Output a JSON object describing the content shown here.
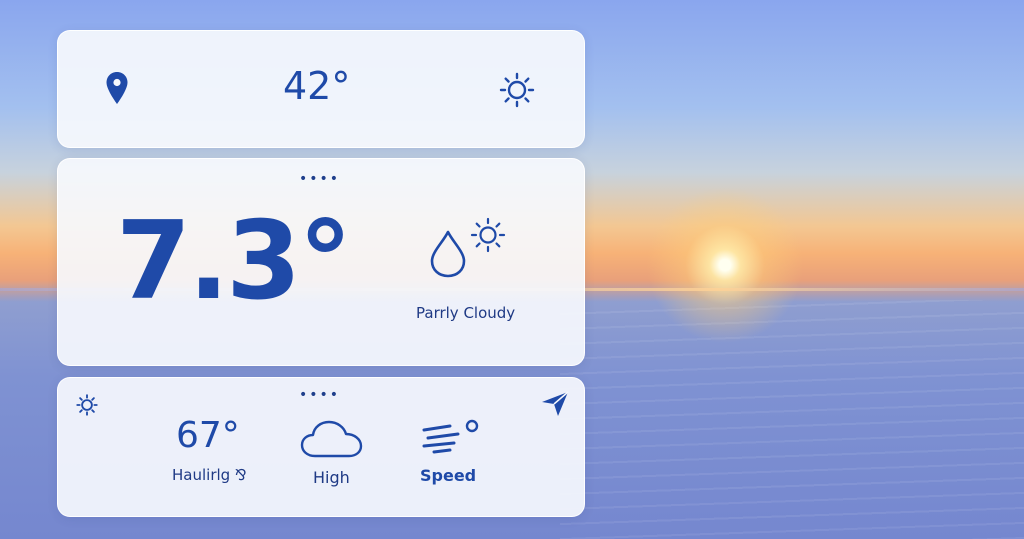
{
  "colors": {
    "accent": "#1f4aa8",
    "card_bg": "#f6f8fd"
  },
  "top_bar": {
    "location_icon": "map-pin-icon",
    "temperature": "42°",
    "settings_icon": "sun-gear-icon"
  },
  "current": {
    "temperature": "7.3°",
    "page_dots": "••••",
    "condition_icons": [
      "raindrop-icon",
      "sun-icon"
    ],
    "condition": "Parrly Cloudy"
  },
  "details": {
    "page_dots": "••••",
    "corner_left_icon": "sun-gear-icon",
    "corner_right_icon": "navigation-arrow-icon",
    "items": [
      {
        "value": "67°",
        "label": "Haulirlg ⅋"
      },
      {
        "icon": "cloud-icon",
        "label": "High"
      },
      {
        "icon": "wind-icon",
        "label": "Speed"
      }
    ]
  }
}
